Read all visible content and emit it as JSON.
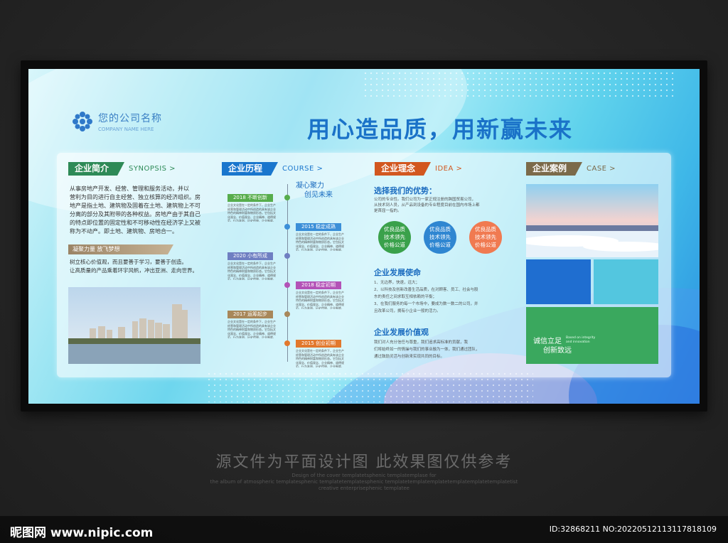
{
  "header": {
    "company_cn": "您的公司名称",
    "company_en": "COMPANY NAME HERE",
    "slogan": "用心造品质，用新赢未来"
  },
  "synopsis": {
    "tag": "企业简介",
    "sub": "SYNOPSIS >",
    "color": "#2e8a57",
    "body": [
      "从事房地产开发、经营、管理和服务活动，并以",
      "营利为目的进行自主经营、独立核算的经济组织。房",
      "地产是指土地、建筑物及固着在土地、建筑物上不可",
      "分离的部分及其附带的各种权益。房地产由于其自己",
      "的特点即位置的固定性和不可移动性在经济学上又被",
      "称为不动产。即土地、建筑物、房地合一。"
    ],
    "sub_title": "凝聚力量 放飞梦想",
    "body2": [
      "树立核心价值观，而且要善于学习，要善于创造。",
      "让高质量的产品乘着环宇风帆，冲出亚洲、走向世界。"
    ]
  },
  "course": {
    "tag": "企业历程",
    "sub": "COURSE >",
    "top_lines": [
      "凝心聚力",
      "创见未来"
    ],
    "items": [
      {
        "label": "2018 不断创新",
        "color": "#57ad4c",
        "side": "left"
      },
      {
        "label": "2015 稳定成熟",
        "color": "#3b8fd8",
        "side": "right"
      },
      {
        "label": "2020 小有所成",
        "color": "#6f7fc2",
        "side": "left"
      },
      {
        "label": "2018 稳定初期",
        "color": "#b352b7",
        "side": "right"
      },
      {
        "label": "2017 运筹起步",
        "color": "#a8875a",
        "side": "left"
      },
      {
        "label": "2015 创业初期",
        "color": "#e2782d",
        "side": "right"
      }
    ],
    "item_text": "企业文化是在一定的条件下，企业生产经营和管理活动中所创造的具有该企业特色的精神财富和物质形态。它包括文化观念、价值观念、企业精神、道德规范、行为准则、历史传统、企业制度、文化环境、企业产品等。其中价值观是企业文化的核心。"
  },
  "idea": {
    "tag": "企业理念",
    "sub": "IDEA >",
    "adv_title": "选择我们的优势：",
    "adv_text": [
      "公司的专业性。我们公司为一家正规注册的跨国贸易公司，",
      "从技术到人员，从产品到设备的专业程度目前在国内市场上都",
      "是首屈一指的。"
    ],
    "circles": [
      {
        "lines": [
          "优良品质",
          "技术领先",
          "价格公道"
        ],
        "color": "#3aa14b"
      },
      {
        "lines": [
          "优良品质",
          "技术领先",
          "价格公道"
        ],
        "color": "#2f86d1"
      },
      {
        "lines": [
          "优良品质",
          "技术领先",
          "价格公道"
        ],
        "color": "#f07a51"
      }
    ],
    "mission_title": "企业发展使命",
    "mission": [
      "1、无边界，快速，远大；",
      "2、以科技及创新改善生活品质，在对顾客、员工、社会与股",
      "东的责任之间求取互相依赖的平衡；",
      "3、在我们服务的每一个市场中，要成为数一数二的公司，并",
      "且改革公司，拥有小企业一般的活力。"
    ],
    "value_title": "企业发展价值观",
    "value": [
      "我们对人充分信任与尊重，我们追求高标准的贡献，我",
      "们将始终如一的情操与我们的事业融为一体，我们通过团队，",
      "通过鼓励灵活与创新来实现共同的目标。"
    ]
  },
  "case": {
    "tag": "企业案例",
    "sub": "CASE >",
    "green_main": [
      "诚信立足",
      "创新致远"
    ],
    "green_small": [
      "Based on integrity",
      "and innovation"
    ]
  },
  "footer": {
    "watermark_cn": "源文件为平面设计图 此效果图仅供参考",
    "watermark_en": [
      "Design of the cover templatetsphenic templatemplase for",
      "the album of atmospheric templatesphenic templatetemplatesphenic templatetemplatemplatetemplatemplatetemplatetist",
      "creative enterprisephenic templatee"
    ],
    "site": "昵图网 www.nipic.com",
    "id": "ID:32868211 NO:20220512113117818109"
  }
}
